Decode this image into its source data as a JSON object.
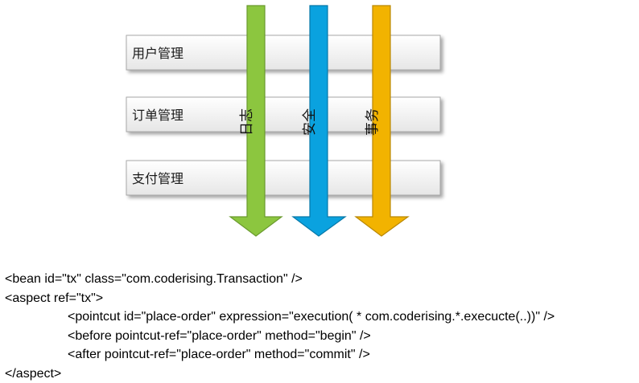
{
  "modules": [
    {
      "label": "用户管理"
    },
    {
      "label": "订单管理"
    },
    {
      "label": "支付管理"
    }
  ],
  "aspects": [
    {
      "label": "日志",
      "color": "#8cc63f",
      "stroke": "#6a9a2e"
    },
    {
      "label": "安全",
      "color": "#0aa2df",
      "stroke": "#0778a8"
    },
    {
      "label": "事务",
      "color": "#f2b300",
      "stroke": "#b98700"
    }
  ],
  "code_lines": [
    "<bean id=\"tx\" class=\"com.coderising.Transaction\" />",
    "<aspect ref=\"tx\">",
    "<pointcut id=\"place-order\" expression=\"execution( * com.coderising.*.execucte(..))\" />",
    "<before pointcut-ref=\"place-order\" method=\"begin\" />",
    "<after pointcut-ref=\"place-order\" method=\"commit\" />",
    "</aspect>"
  ]
}
